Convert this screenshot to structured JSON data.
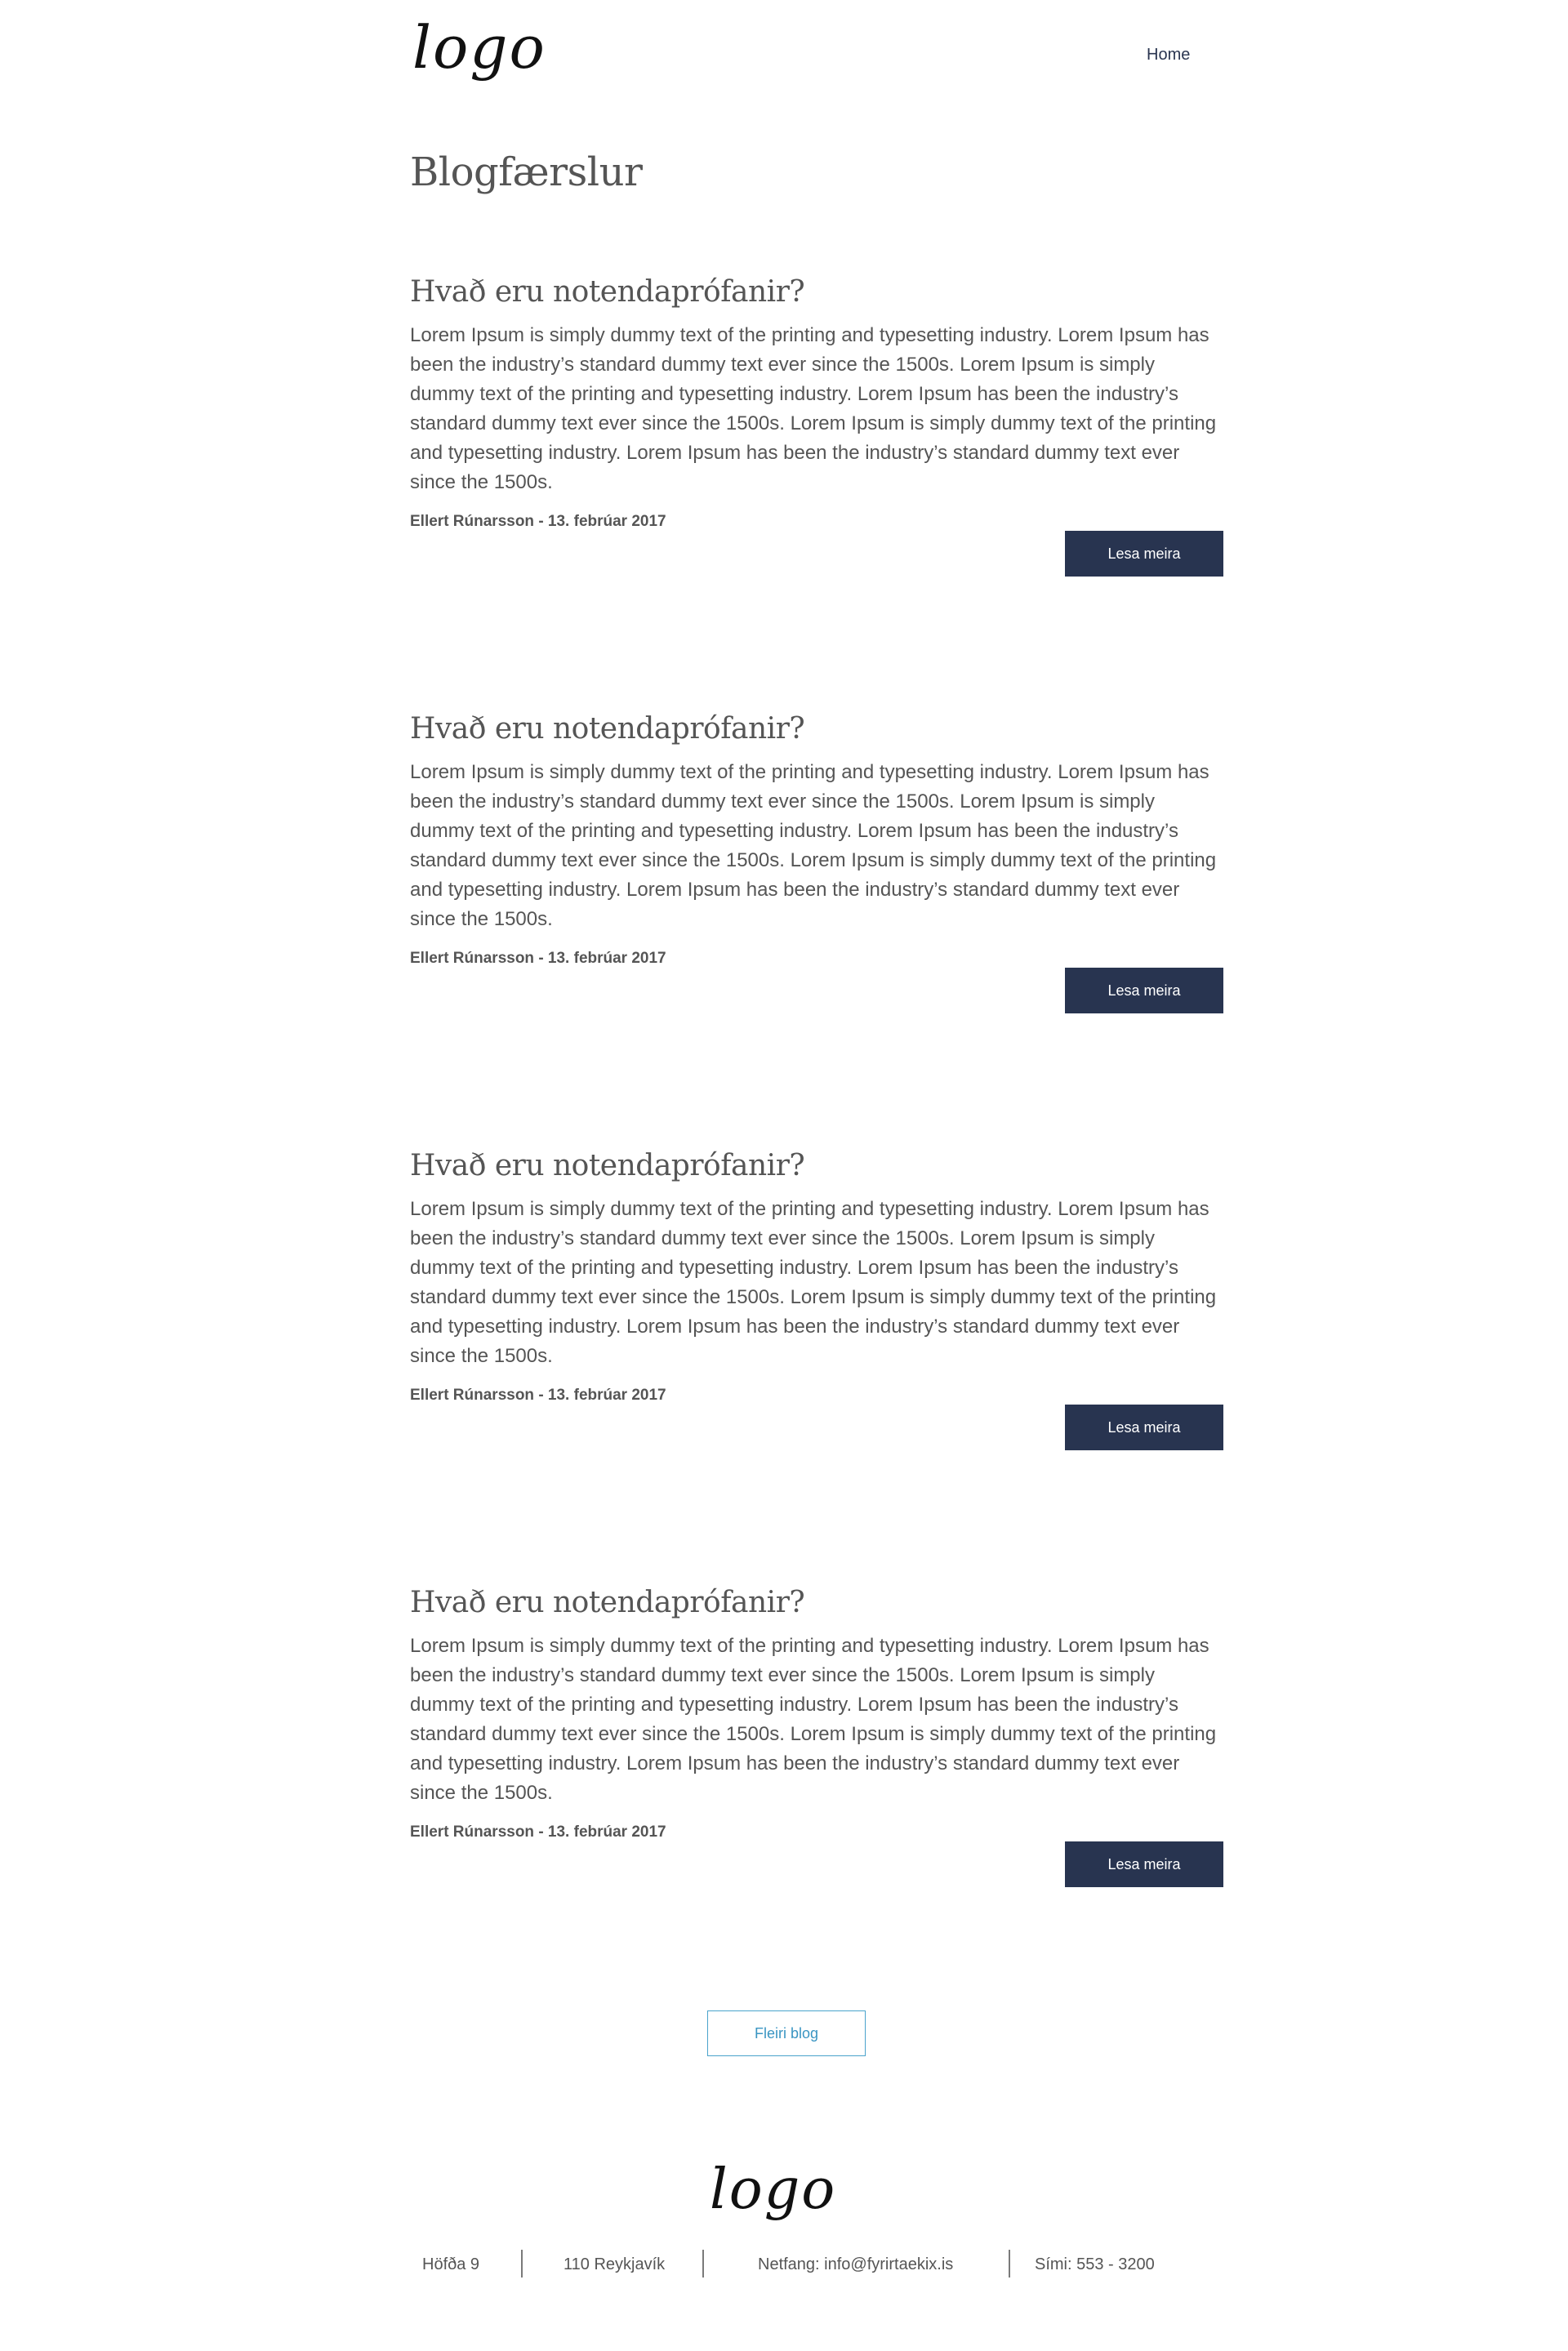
{
  "header": {
    "logo": "logo",
    "nav": {
      "home": "Home"
    }
  },
  "page_title": "Blogfærslur",
  "posts": [
    {
      "title": "Hvað eru notendaprófanir?",
      "body": "Lorem Ipsum is simply dummy text of the printing and typesetting industry. Lorem Ipsum has been the industry’s standard dummy text ever since the 1500s. Lorem Ipsum is simply dummy text of the printing and typesetting industry. Lorem Ipsum has been the industry’s standard dummy text ever since the 1500s. Lorem Ipsum is simply dummy text of the printing and typesetting industry. Lorem Ipsum has been the industry’s standard dummy text ever since the 1500s.",
      "meta": "Ellert Rúnarsson - 13. febrúar 2017",
      "button": "Lesa meira"
    },
    {
      "title": "Hvað eru notendaprófanir?",
      "body": "Lorem Ipsum is simply dummy text of the printing and typesetting industry. Lorem Ipsum has been the industry’s standard dummy text ever since the 1500s. Lorem Ipsum is simply dummy text of the printing and typesetting industry. Lorem Ipsum has been the industry’s standard dummy text ever since the 1500s. Lorem Ipsum is simply dummy text of the printing and typesetting industry. Lorem Ipsum has been the industry’s standard dummy text ever since the 1500s.",
      "meta": "Ellert Rúnarsson - 13. febrúar 2017",
      "button": "Lesa meira"
    },
    {
      "title": "Hvað eru notendaprófanir?",
      "body": "Lorem Ipsum is simply dummy text of the printing and typesetting industry. Lorem Ipsum has been the industry’s standard dummy text ever since the 1500s. Lorem Ipsum is simply dummy text of the printing and typesetting industry. Lorem Ipsum has been the industry’s standard dummy text ever since the 1500s. Lorem Ipsum is simply dummy text of the printing and typesetting industry. Lorem Ipsum has been the industry’s standard dummy text ever since the 1500s.",
      "meta": "Ellert Rúnarsson - 13. febrúar 2017",
      "button": "Lesa meira"
    },
    {
      "title": "Hvað eru notendaprófanir?",
      "body": "Lorem Ipsum is simply dummy text of the printing and typesetting industry. Lorem Ipsum has been the industry’s standard dummy text ever since the 1500s. Lorem Ipsum is simply dummy text of the printing and typesetting industry. Lorem Ipsum has been the industry’s standard dummy text ever since the 1500s. Lorem Ipsum is simply dummy text of the printing and typesetting industry. Lorem Ipsum has been the industry’s standard dummy text ever since the 1500s.",
      "meta": "Ellert Rúnarsson - 13. febrúar 2017",
      "button": "Lesa meira"
    }
  ],
  "more_button": "Fleiri blog",
  "footer": {
    "logo": "logo",
    "address": "Höfða 9",
    "postcode": "110 Reykjavík",
    "email": "Netfang: info@fyrirtaekix.is",
    "phone": "Sími: 553 - 3200"
  },
  "colors": {
    "primary_button": "#283450",
    "accent_outline": "#4aa3cc",
    "text": "#555555"
  }
}
